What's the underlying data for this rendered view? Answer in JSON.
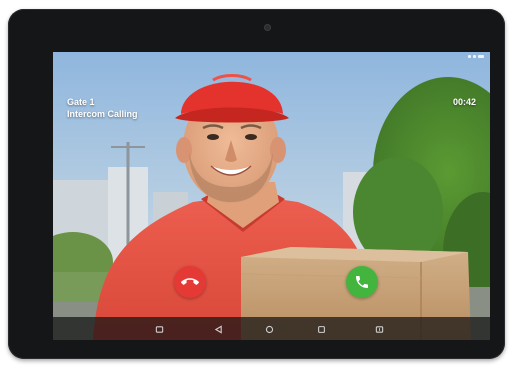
{
  "call": {
    "caller_name": "Gate 1",
    "caller_subtitle": "Intercom Calling",
    "duration": "00:42"
  },
  "actions": {
    "decline_icon": "phone-hangup-icon",
    "accept_icon": "phone-icon",
    "decline_color": "#e53935",
    "accept_color": "#43b53f"
  },
  "navigation": {
    "icons": [
      "recent-apps-icon",
      "back-icon",
      "home-icon",
      "overview-icon",
      "screenshot-icon"
    ]
  }
}
